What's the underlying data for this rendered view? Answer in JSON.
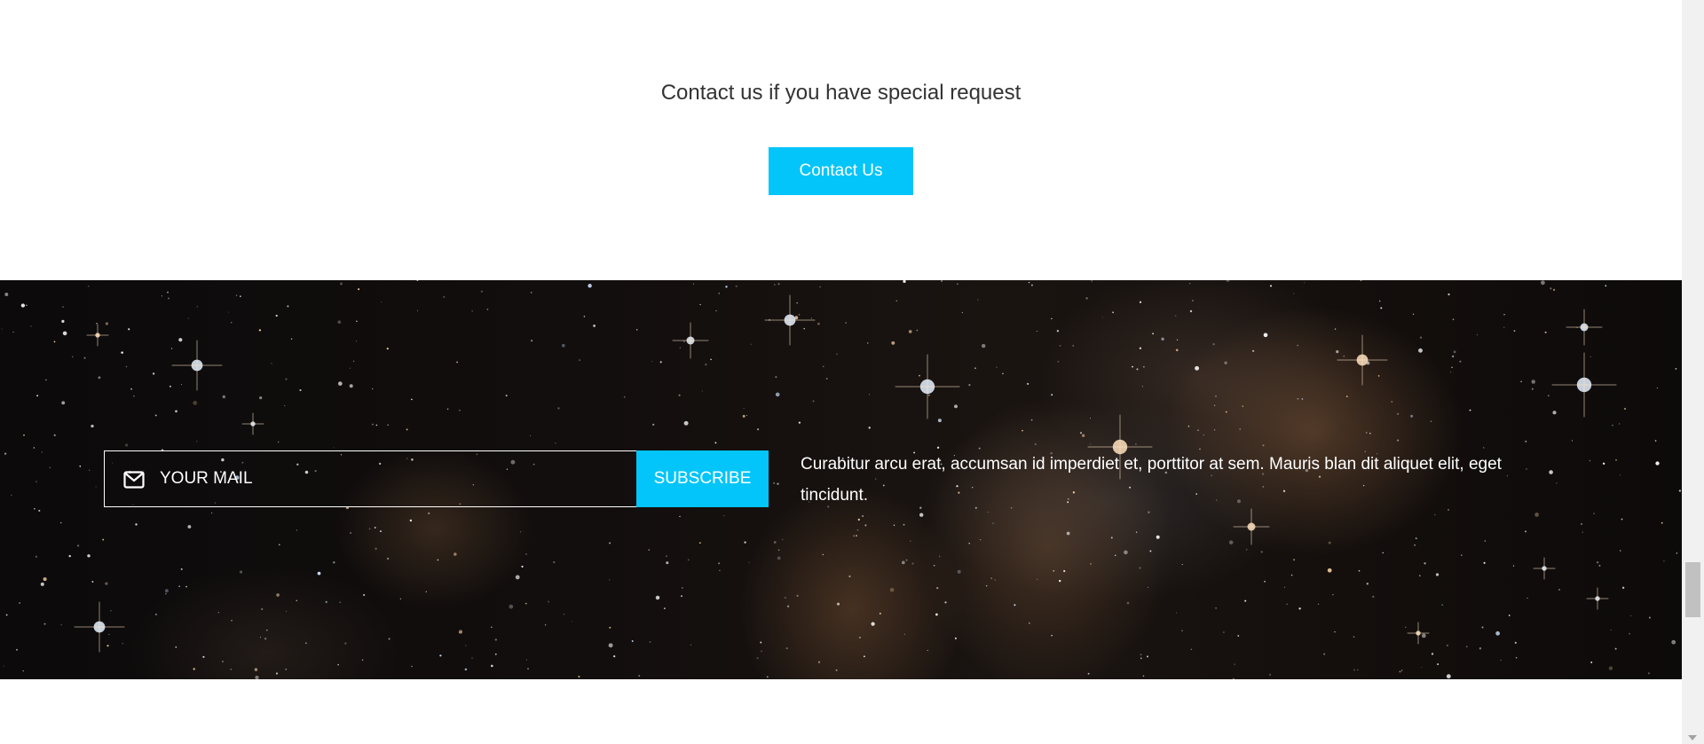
{
  "contact": {
    "heading": "Contact us if you have special request",
    "button_label": "Contact Us"
  },
  "newsletter": {
    "input_placeholder": "YOUR MAIL",
    "icon": "envelope-icon",
    "subscribe_label": "SUBSCRIBE",
    "description": "Curabitur arcu erat, accumsan id imperdiet et, porttitor at sem. Mauris blan dit aliquet elit, eget tincidunt.",
    "background": "starfield-image"
  },
  "colors": {
    "accent": "#04c5f9",
    "heading_text": "#333333",
    "white": "#ffffff"
  }
}
